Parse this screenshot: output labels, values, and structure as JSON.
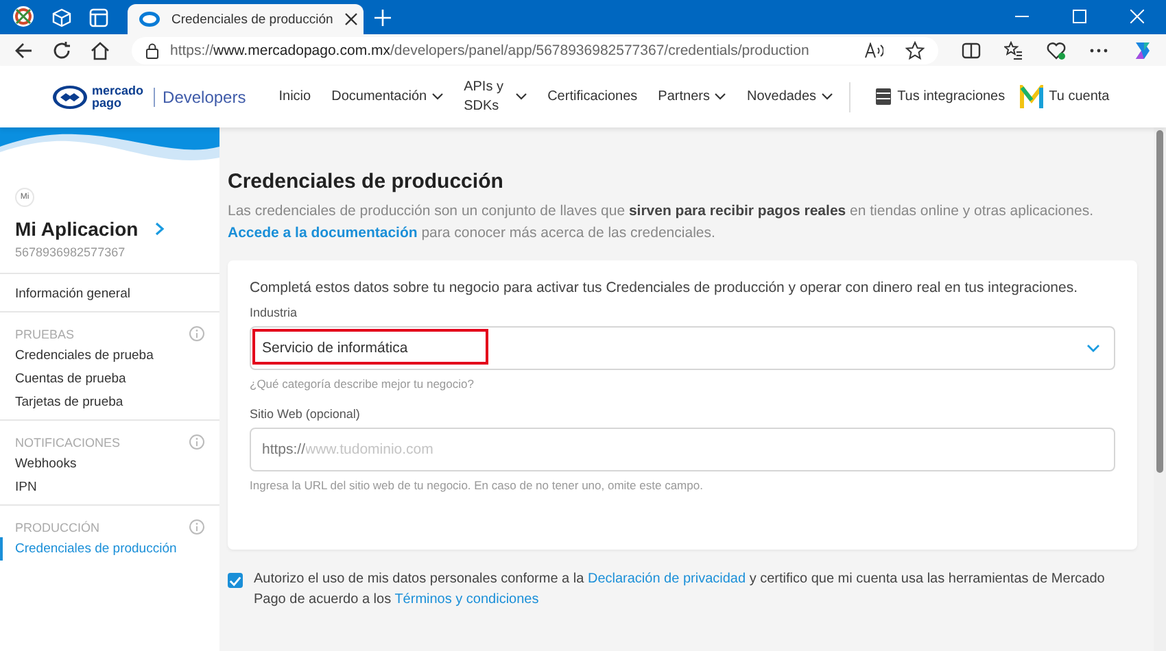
{
  "browser": {
    "tab_title": "Credenciales de producción",
    "url_prefix": "https://",
    "url_domain": "www.mercadopago.com.mx",
    "url_path": "/developers/panel/app/5678936982577367/credentials/production"
  },
  "header": {
    "brand_lines": [
      "mercado",
      "pago"
    ],
    "section": "Developers",
    "nav": [
      {
        "label": "Inicio",
        "has_menu": false
      },
      {
        "label": "Documentación",
        "has_menu": true
      },
      {
        "label": "APIs y SDKs",
        "has_menu": true
      },
      {
        "label": "Certificaciones",
        "has_menu": false
      },
      {
        "label": "Partners",
        "has_menu": true
      },
      {
        "label": "Novedades",
        "has_menu": true
      }
    ],
    "integrations": "Tus integraciones",
    "account": "Tu cuenta"
  },
  "sidebar": {
    "avatar": "Mi",
    "app_name": "Mi Aplicacion",
    "app_id": "5678936982577367",
    "sections": [
      {
        "items": [
          {
            "label": "Información general",
            "selected": false
          }
        ]
      },
      {
        "heading": "PRUEBAS",
        "items": [
          {
            "label": "Credenciales de prueba",
            "selected": false
          },
          {
            "label": "Cuentas de prueba",
            "selected": false
          },
          {
            "label": "Tarjetas de prueba",
            "selected": false
          }
        ]
      },
      {
        "heading": "NOTIFICACIONES",
        "items": [
          {
            "label": "Webhooks",
            "selected": false
          },
          {
            "label": "IPN",
            "selected": false
          }
        ]
      },
      {
        "heading": "PRODUCCIÓN",
        "items": [
          {
            "label": "Credenciales de producción",
            "selected": true
          }
        ]
      }
    ]
  },
  "main": {
    "title": "Credenciales de producción",
    "intro": [
      {
        "kind": "text",
        "text": "Las credenciales de producción son un conjunto de llaves que **sirven para recibir pagos reales** en tiendas online y otras aplicaciones."
      },
      {
        "kind": "link",
        "text": "Accede a la documentación"
      },
      {
        "kind": "text",
        "text": "para conocer más acerca de las credenciales."
      }
    ],
    "card": {
      "intro": "Completá estos datos sobre tu negocio para activar tus Credenciales de producción y operar con dinero real en tus integraciones.",
      "fields": [
        {
          "kind": "select",
          "label": "Industria",
          "value": "Servicio de informática",
          "highlighted": true,
          "hint": "¿Qué categoría describe mejor tu negocio?"
        },
        {
          "kind": "url",
          "label": "Sitio Web (opcional)",
          "prefix": "https://",
          "placeholder": "www.tudominio.com",
          "hint": "Ingresa la URL del sitio web de tu negocio. En caso de no tener uno, omite este campo."
        }
      ]
    },
    "consent": {
      "checked": true,
      "text": [
        {
          "kind": "text",
          "text": "Autorizo el uso de mis datos personales conforme a la"
        },
        {
          "kind": "link",
          "text": "Declaración de privacidad"
        },
        {
          "kind": "text",
          "text": "y certifico que mi cuenta usa las herramientas de Mercado Pago de acuerdo a los"
        },
        {
          "kind": "link",
          "text": "Términos y condiciones"
        }
      ]
    }
  }
}
